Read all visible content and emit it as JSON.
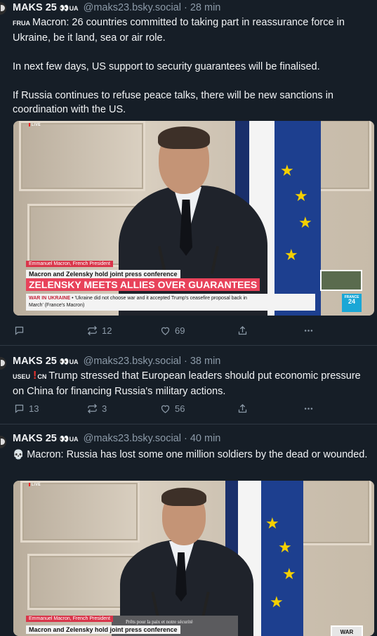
{
  "posts": [
    {
      "author": "MAKS 25",
      "eyes": "👀",
      "badge": "UA",
      "handle": "@maks23.bsky.social · 28 min",
      "flags": "FRUA",
      "paragraphs": [
        "Macron: 26 countries committed to taking part in reassurance force in Ukraine, be it land, sea or air role.",
        "In next few days, US support to security guarantees will be finalised.",
        "If Russia continues to refuse peace talks, there will be new sanctions in coordination with the US."
      ],
      "media": {
        "live_label": "LIVE",
        "name_strap": "Emmanuel Macron, French President",
        "subheading": "Macron and Zelensky hold joint press conference",
        "headline": "ZELENSKY MEETS ALLIES OVER GUARANTEES",
        "ticker_tag": "WAR IN UKRAINE",
        "ticker_line1": " • 'Ukraine did not choose war and it accepted Trump's ceasefire proposal back in",
        "ticker_line2": "March' (France's Macron)",
        "channel_line1": "FRANCE",
        "channel_line2": "24"
      },
      "actions": {
        "reply": "",
        "repost": "12",
        "like": "69"
      }
    },
    {
      "author": "MAKS 25",
      "eyes": "👀",
      "badge": "UA",
      "handle": "@maks23.bsky.social · 38 min",
      "flag_pre": "USEU",
      "excl": "!",
      "flag_post": "CN",
      "text": "Trump stressed that European leaders should put economic pressure on China for financing Russia's military actions.",
      "actions": {
        "reply": "13",
        "repost": "3",
        "like": "56"
      }
    },
    {
      "author": "MAKS 25",
      "eyes": "👀",
      "badge": "UA",
      "handle": "@maks23.bsky.social · 40 min",
      "skull": "💀",
      "text": "Macron: Russia has lost some one million soldiers by the dead or wounded.",
      "media": {
        "live_label": "LIVE",
        "name_strap": "Emmanuel Macron, French President",
        "subheading": "Macron and Zelensky hold joint press conference",
        "podium_text": "Prêts pour la paix et notre sécurité",
        "thumb_label": "WAR"
      }
    }
  ],
  "colors": {
    "background": "#161e27",
    "muted": "#8c9aa8",
    "accent_red": "#e8425a"
  },
  "icons": [
    "reply-icon",
    "repost-icon",
    "like-icon",
    "share-icon",
    "more-icon"
  ]
}
